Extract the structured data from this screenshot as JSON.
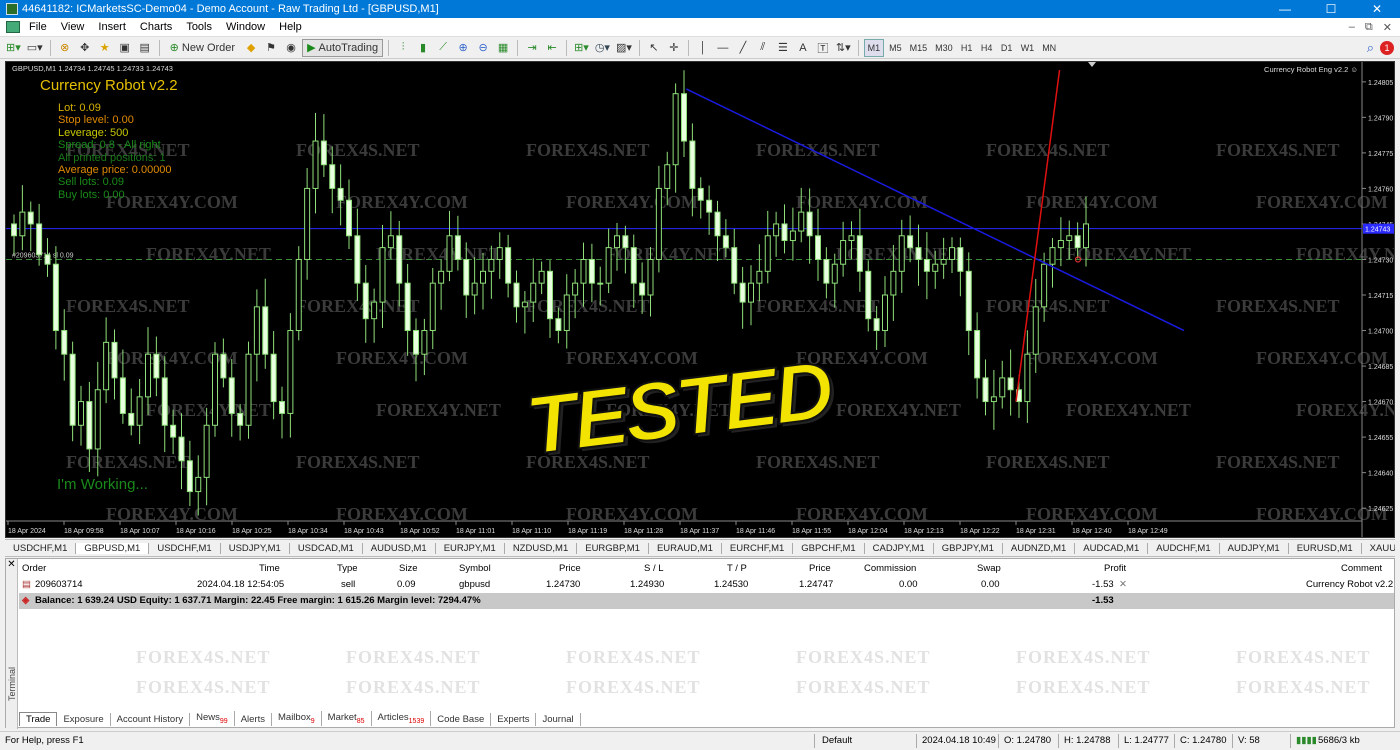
{
  "window": {
    "title": "44641182: ICMarketsSC-Demo04 - Demo Account - Raw Trading Ltd - [GBPUSD,M1]",
    "minimize": "—",
    "maximize": "☐",
    "close": "✕"
  },
  "menu": [
    "File",
    "View",
    "Insert",
    "Charts",
    "Tools",
    "Window",
    "Help"
  ],
  "toolbar": {
    "new_order": "New Order",
    "autotrading": "AutoTrading",
    "timeframes": [
      "M1",
      "M5",
      "M15",
      "M30",
      "H1",
      "H4",
      "D1",
      "W1",
      "MN"
    ],
    "active_timeframe": "M1",
    "text_tool": "A",
    "notif_count": "1"
  },
  "chart": {
    "header": "GBPUSD,M1  1.24734 1.24745 1.24733 1.24743",
    "ea_name": "Currency Robot Eng v2.2 ☺",
    "robot_title": "Currency Robot  v2.2",
    "info_lines": [
      {
        "text": "Lot: 0.09",
        "color": "#d4b000"
      },
      {
        "text": "Stop level: 0.00",
        "color": "#e08a00"
      },
      {
        "text": "Leverage: 500",
        "color": "#c7c700"
      },
      {
        "text": "Spread: 0.8 - All right",
        "color": "#1a8a1a"
      },
      {
        "text": "All printed positions: 1",
        "color": "#1a7a1a"
      },
      {
        "text": "Average price: 0.00000",
        "color": "#e08a00"
      },
      {
        "text": "Sell lots: 0.09",
        "color": "#1a8a1a"
      },
      {
        "text": "Buy lots: 0.00",
        "color": "#1a8a1a"
      }
    ],
    "working": "I'm Working...",
    "stamp": "TESTED",
    "order_label": "#209603714 sl 0.09",
    "price_ticks": [
      "1.24805",
      "1.24790",
      "1.24775",
      "1.24760",
      "1.24745",
      "1.24730",
      "1.24715",
      "1.24700",
      "1.24685",
      "1.24670",
      "1.24655",
      "1.24640",
      "1.24625"
    ],
    "current_price": "1.24743",
    "time_ticks": [
      "18 Apr 2024",
      "18 Apr 09:58",
      "18 Apr 10:07",
      "18 Apr 10:16",
      "18 Apr 10:25",
      "18 Apr 10:34",
      "18 Apr 10:43",
      "18 Apr 10:52",
      "18 Apr 11:01",
      "18 Apr 11:10",
      "18 Apr 11:19",
      "18 Apr 11:28",
      "18 Apr 11:37",
      "18 Apr 11:46",
      "18 Apr 11:55",
      "18 Apr 12:04",
      "18 Apr 12:13",
      "18 Apr 12:22",
      "18 Apr 12:31",
      "18 Apr 12:40",
      "18 Apr 12:49"
    ],
    "watermarks": [
      "FOREX4S.NET",
      "FOREX4Y.COM",
      "FOREX4Y.NET"
    ]
  },
  "chart_data": {
    "type": "candlestick",
    "symbol": "GBPUSD,M1",
    "ylim": [
      1.2462,
      1.2481
    ],
    "close_series": [
      1.2474,
      1.2475,
      1.24745,
      1.24732,
      1.24728,
      1.247,
      1.2469,
      1.2466,
      1.2467,
      1.2465,
      1.24675,
      1.24695,
      1.2468,
      1.24665,
      1.2466,
      1.24672,
      1.2469,
      1.2468,
      1.2466,
      1.24655,
      1.24645,
      1.24632,
      1.24638,
      1.2466,
      1.2469,
      1.2468,
      1.24665,
      1.2466,
      1.2469,
      1.2471,
      1.2469,
      1.2467,
      1.24665,
      1.247,
      1.2473,
      1.2476,
      1.2478,
      1.2477,
      1.2476,
      1.24755,
      1.2474,
      1.2472,
      1.24705,
      1.24712,
      1.24735,
      1.2474,
      1.2472,
      1.247,
      1.2469,
      1.247,
      1.2472,
      1.24725,
      1.2474,
      1.2473,
      1.24715,
      1.2472,
      1.24725,
      1.2473,
      1.24735,
      1.2472,
      1.2471,
      1.24712,
      1.2472,
      1.24725,
      1.24705,
      1.247,
      1.24715,
      1.2472,
      1.2473,
      1.2472,
      1.2472,
      1.24735,
      1.2474,
      1.24735,
      1.2472,
      1.24715,
      1.2473,
      1.2476,
      1.2477,
      1.248,
      1.2478,
      1.2476,
      1.24755,
      1.2475,
      1.2474,
      1.24735,
      1.2472,
      1.24712,
      1.2472,
      1.24725,
      1.2474,
      1.24745,
      1.24738,
      1.24742,
      1.2475,
      1.2474,
      1.2473,
      1.2472,
      1.24728,
      1.24738,
      1.2474,
      1.24725,
      1.24705,
      1.247,
      1.24715,
      1.24725,
      1.2474,
      1.24735,
      1.2473,
      1.24725,
      1.24728,
      1.2473,
      1.24735,
      1.24725,
      1.247,
      1.2468,
      1.2467,
      1.24672,
      1.2468,
      1.24675,
      1.2467,
      1.2469,
      1.2471,
      1.24728,
      1.24735,
      1.24738,
      1.2474,
      1.24735,
      1.24745
    ],
    "trendlines": [
      {
        "name": "resistance",
        "color": "#1a1ae0",
        "from": [
          "18 Apr 11:38",
          1.24802
        ],
        "to": [
          "18 Apr 12:58",
          1.247
        ]
      },
      {
        "name": "fast-up",
        "color": "#e01010",
        "from": [
          "18 Apr 12:31",
          1.2467
        ],
        "to": [
          "18 Apr 12:38",
          1.2481
        ]
      }
    ],
    "hlines": [
      {
        "price": 1.24743,
        "color": "#2a2aff",
        "style": "solid"
      },
      {
        "price": 1.2473,
        "color": "#3a8a3a",
        "style": "dashed"
      }
    ]
  },
  "symbol_tabs": [
    "USDCHF,M1",
    "GBPUSD,M1",
    "USDCHF,M1",
    "USDJPY,M1",
    "USDCAD,M1",
    "AUDUSD,M1",
    "EURJPY,M1",
    "NZDUSD,M1",
    "EURGBP,M1",
    "EURAUD,M1",
    "EURCHF,M1",
    "GBPCHF,M1",
    "CADJPY,M1",
    "GBPJPY,M1",
    "AUDNZD,M1",
    "AUDCAD,M1",
    "AUDCHF,M1",
    "AUDJPY,M1",
    "EURUSD,M1",
    "XAUUSD,M1"
  ],
  "terminal": {
    "columns": [
      "Order",
      "Time",
      "Type",
      "Size",
      "Symbol",
      "Price",
      "S / L",
      "T / P",
      "Price",
      "Commission",
      "Swap",
      "Profit",
      "Comment"
    ],
    "row": {
      "order": "209603714",
      "time": "2024.04.18 12:54:05",
      "type": "sell",
      "size": "0.09",
      "symbol": "gbpusd",
      "price": "1.24730",
      "sl": "1.24930",
      "tp": "1.24530",
      "cur_price": "1.24747",
      "commission": "0.00",
      "swap": "0.00",
      "profit": "-1.53",
      "close": "✕",
      "comment": "Currency Robot v2.2"
    },
    "balance": "Balance: 1 639.24 USD  Equity: 1 637.71  Margin: 22.45  Free margin: 1 615.26  Margin level: 7294.47%",
    "total": "-1.53",
    "side_label": "Terminal",
    "tabs": [
      {
        "label": "Trade",
        "count": ""
      },
      {
        "label": "Exposure",
        "count": ""
      },
      {
        "label": "Account History",
        "count": ""
      },
      {
        "label": "News",
        "count": "99"
      },
      {
        "label": "Alerts",
        "count": ""
      },
      {
        "label": "Mailbox",
        "count": "9"
      },
      {
        "label": "Market",
        "count": "85"
      },
      {
        "label": "Articles",
        "count": "1539"
      },
      {
        "label": "Code Base",
        "count": ""
      },
      {
        "label": "Experts",
        "count": ""
      },
      {
        "label": "Journal",
        "count": ""
      }
    ],
    "watermark": "FOREX4S.NET"
  },
  "status": {
    "help": "For Help, press F1",
    "profile": "Default",
    "datetime": "2024.04.18 10:49",
    "open": "O: 1.24780",
    "high": "H: 1.24788",
    "low": "L: 1.24777",
    "close": "C: 1.24780",
    "volume": "V: 58",
    "traffic": "5686/3 kb"
  }
}
